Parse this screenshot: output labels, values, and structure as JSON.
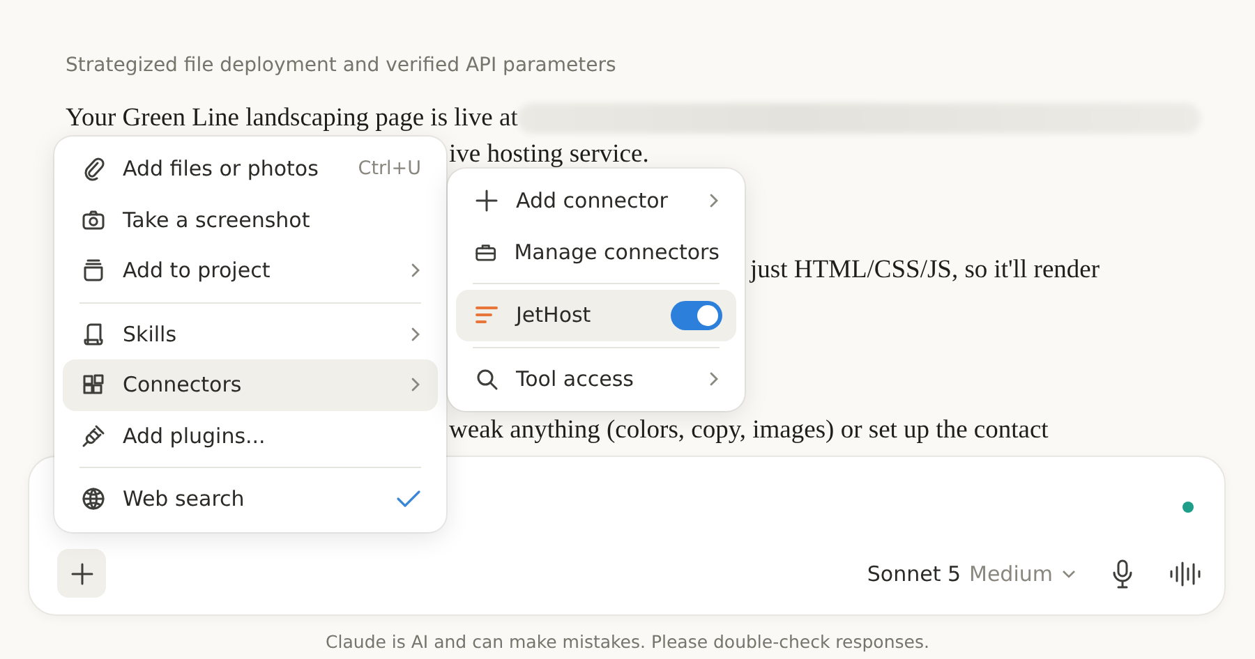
{
  "thread": {
    "status_note": "Strategized file deployment and verified API parameters",
    "lines": [
      "Your Green Line landscaping page is live at ",
      "ive hosting service.",
      "just HTML/CSS/JS, so it'll render",
      "weak anything (colors, copy, images) or set up the contact"
    ]
  },
  "attach_menu": {
    "groups": [
      [
        {
          "label": "Add files or photos",
          "shortcut": "Ctrl+U",
          "has_submenu": false,
          "selected": false,
          "checked": false
        },
        {
          "label": "Take a screenshot",
          "has_submenu": false,
          "selected": false,
          "checked": false
        },
        {
          "label": "Add to project",
          "has_submenu": true,
          "selected": false,
          "checked": false
        }
      ],
      [
        {
          "label": "Skills",
          "has_submenu": true,
          "selected": false,
          "checked": false
        },
        {
          "label": "Connectors",
          "has_submenu": true,
          "selected": true,
          "checked": false
        },
        {
          "label": "Add plugins...",
          "has_submenu": false,
          "selected": false,
          "checked": false
        }
      ],
      [
        {
          "label": "Web search",
          "has_submenu": false,
          "selected": false,
          "checked": true
        }
      ]
    ]
  },
  "connectors_menu": {
    "groups": [
      [
        {
          "label": "Add connector",
          "has_submenu": true,
          "selected": false
        },
        {
          "label": "Manage connectors",
          "has_submenu": false,
          "selected": false
        }
      ],
      [
        {
          "label": "JetHost",
          "has_submenu": false,
          "selected": true,
          "toggle": {
            "on": true
          }
        }
      ],
      [
        {
          "label": "Tool access",
          "has_submenu": true,
          "selected": false
        }
      ]
    ]
  },
  "composer": {
    "model": "Sonnet 5",
    "effort": "Medium",
    "status_dot": {
      "color": "#1f9e8a"
    }
  },
  "footer": "Claude is AI and can make mistakes. Please double-check responses."
}
